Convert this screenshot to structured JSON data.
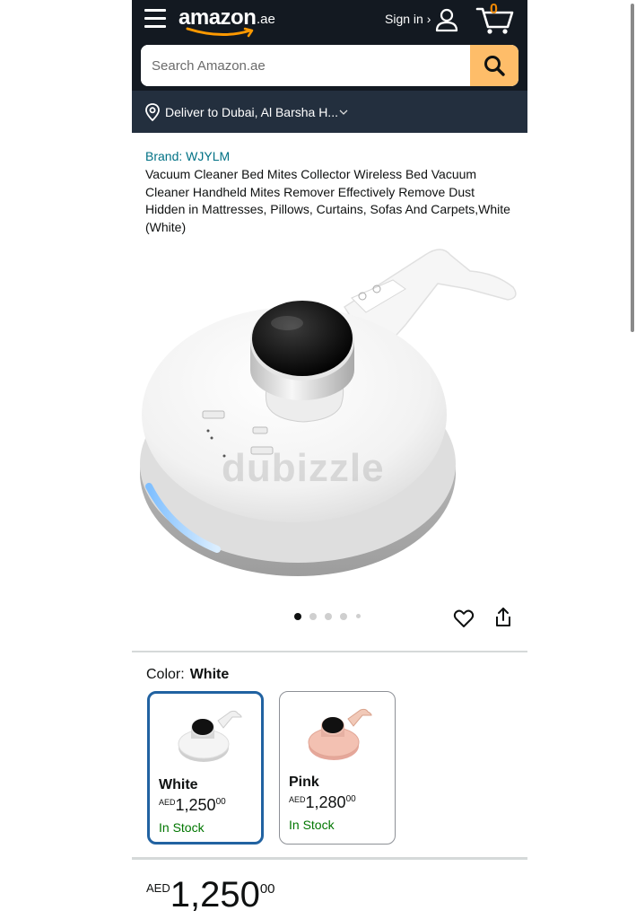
{
  "header": {
    "logo_text": "amazon",
    "logo_tld": ".ae",
    "signin_label": "Sign in ›",
    "cart_count": "0",
    "search_placeholder": "Search Amazon.ae",
    "deliver_text": "Deliver to Dubai, Al Barsha H..."
  },
  "product": {
    "brand": "Brand: WJYLM",
    "title": "Vacuum Cleaner Bed Mites Collector Wireless Bed Vacuum Cleaner Handheld Mites Remover Effectively Remove Dust Hidden in Mattresses, Pillows, Curtains, Sofas And Carpets,White (White)",
    "image_watermark": "dubizzle",
    "image_carousel": {
      "count": 5,
      "active_index": 0
    }
  },
  "color": {
    "label": "Color:",
    "selected_value": "White",
    "options": [
      {
        "name": "White",
        "currency": "AED",
        "whole": "1,250",
        "fraction": "00",
        "stock": "In Stock"
      },
      {
        "name": "Pink",
        "currency": "AED",
        "whole": "1,280",
        "fraction": "00",
        "stock": "In Stock"
      }
    ]
  },
  "price": {
    "currency": "AED",
    "whole": "1,250",
    "fraction": "00"
  },
  "colors": {
    "header_bg": "#131921",
    "deliver_bg": "#232f3e",
    "search_button": "#febd69",
    "cart_count": "#f08804",
    "link": "#007185",
    "in_stock": "#007600",
    "selected_border": "#2162a1"
  }
}
